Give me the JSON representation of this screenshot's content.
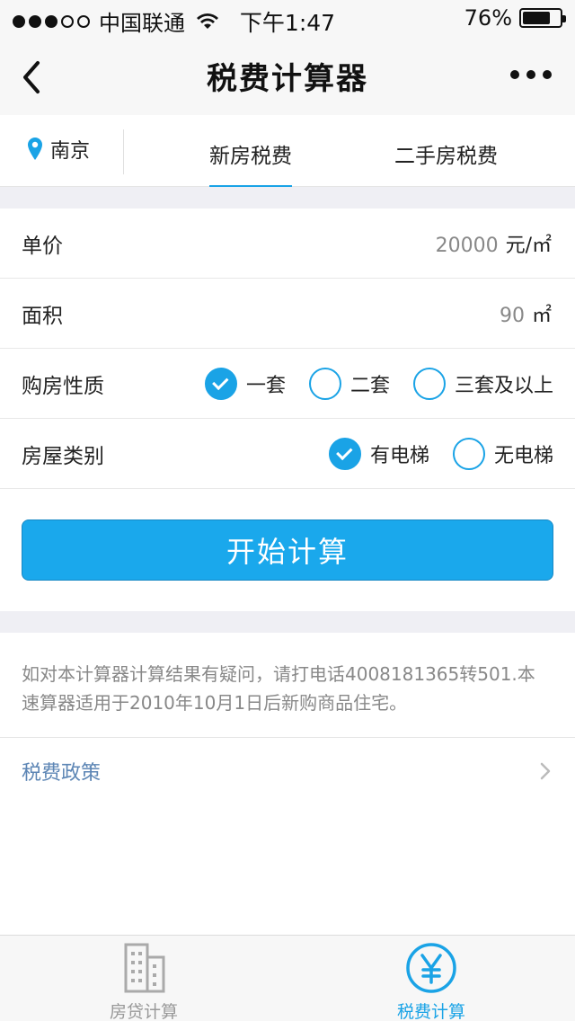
{
  "status_bar": {
    "carrier": "中国联通",
    "time": "下午1:47",
    "battery": "76%",
    "battery_level": 0.76
  },
  "header": {
    "title": "税费计算器",
    "back_icon": "chevron-left-icon",
    "more_icon": "more-horizontal-icon"
  },
  "tabs": {
    "city": "南京",
    "city_icon": "location-pin-icon",
    "items": [
      {
        "label": "新房税费",
        "active": true
      },
      {
        "label": "二手房税费",
        "active": false
      }
    ],
    "accent": "#1aa3e6"
  },
  "form": {
    "price": {
      "label": "单价",
      "value": "20000",
      "unit": "元/㎡"
    },
    "area": {
      "label": "面积",
      "value": "90",
      "unit": "㎡"
    },
    "purchase_type": {
      "label": "购房性质",
      "options": [
        {
          "label": "一套",
          "checked": true
        },
        {
          "label": "二套",
          "checked": false
        },
        {
          "label": "三套及以上",
          "checked": false
        }
      ]
    },
    "house_category": {
      "label": "房屋类别",
      "options": [
        {
          "label": "有电梯",
          "checked": true
        },
        {
          "label": "无电梯",
          "checked": false
        }
      ]
    }
  },
  "calc_button": {
    "label": "开始计算",
    "color": "#1aa8ec"
  },
  "notice": "如对本计算器计算结果有疑问，请打电话4008181365转501.本速算器适用于2010年10月1日后新购商品住宅。",
  "policy": {
    "label": "税费政策",
    "icon": "chevron-right-icon"
  },
  "bottom_nav": {
    "items": [
      {
        "label": "房贷计算",
        "icon": "building-icon",
        "active": false
      },
      {
        "label": "税费计算",
        "icon": "yen-circle-icon",
        "active": true
      }
    ]
  }
}
